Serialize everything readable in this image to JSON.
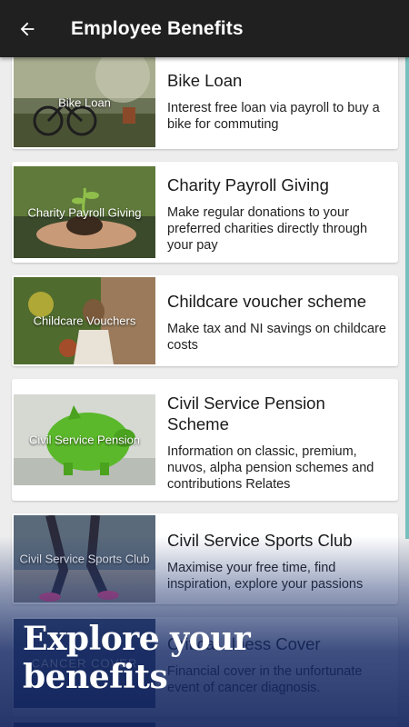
{
  "header": {
    "title": "Employee Benefits",
    "back_icon": "arrow-left-icon"
  },
  "benefits": [
    {
      "thumb_label": "Bike Loan",
      "title": "Bike Loan",
      "description": "Interest free loan via payroll to buy a bike for commuting"
    },
    {
      "thumb_label": "Charity Payroll Giving",
      "title": "Charity Payroll Giving",
      "description": "Make regular donations to your preferred charities directly through your pay"
    },
    {
      "thumb_label": "Childcare Vouchers",
      "title": "Childcare voucher scheme",
      "description": "Make tax and NI savings on childcare costs"
    },
    {
      "thumb_label": "Civil Service Pension",
      "title": "Civil Service Pension Scheme",
      "description": "Information on classic, premium, nuvos, alpha pension schemes and contributions Relates"
    },
    {
      "thumb_label": "Civil Service Sports Club",
      "title": "Civil Service Sports Club",
      "description": "Maximise your free time, find inspiration, explore your passions"
    },
    {
      "thumb_label": "CANCER COVER",
      "title": "Critical Illness Cover",
      "description": "Financial cover in the unfortunate event of cancer diagnosis."
    }
  ],
  "promo": {
    "line1": "Explore your",
    "line2": "benefits"
  },
  "colors": {
    "app_bar": "#202020",
    "accent_scroll": "#5bb3b0",
    "promo_blue": "#1c326e"
  }
}
